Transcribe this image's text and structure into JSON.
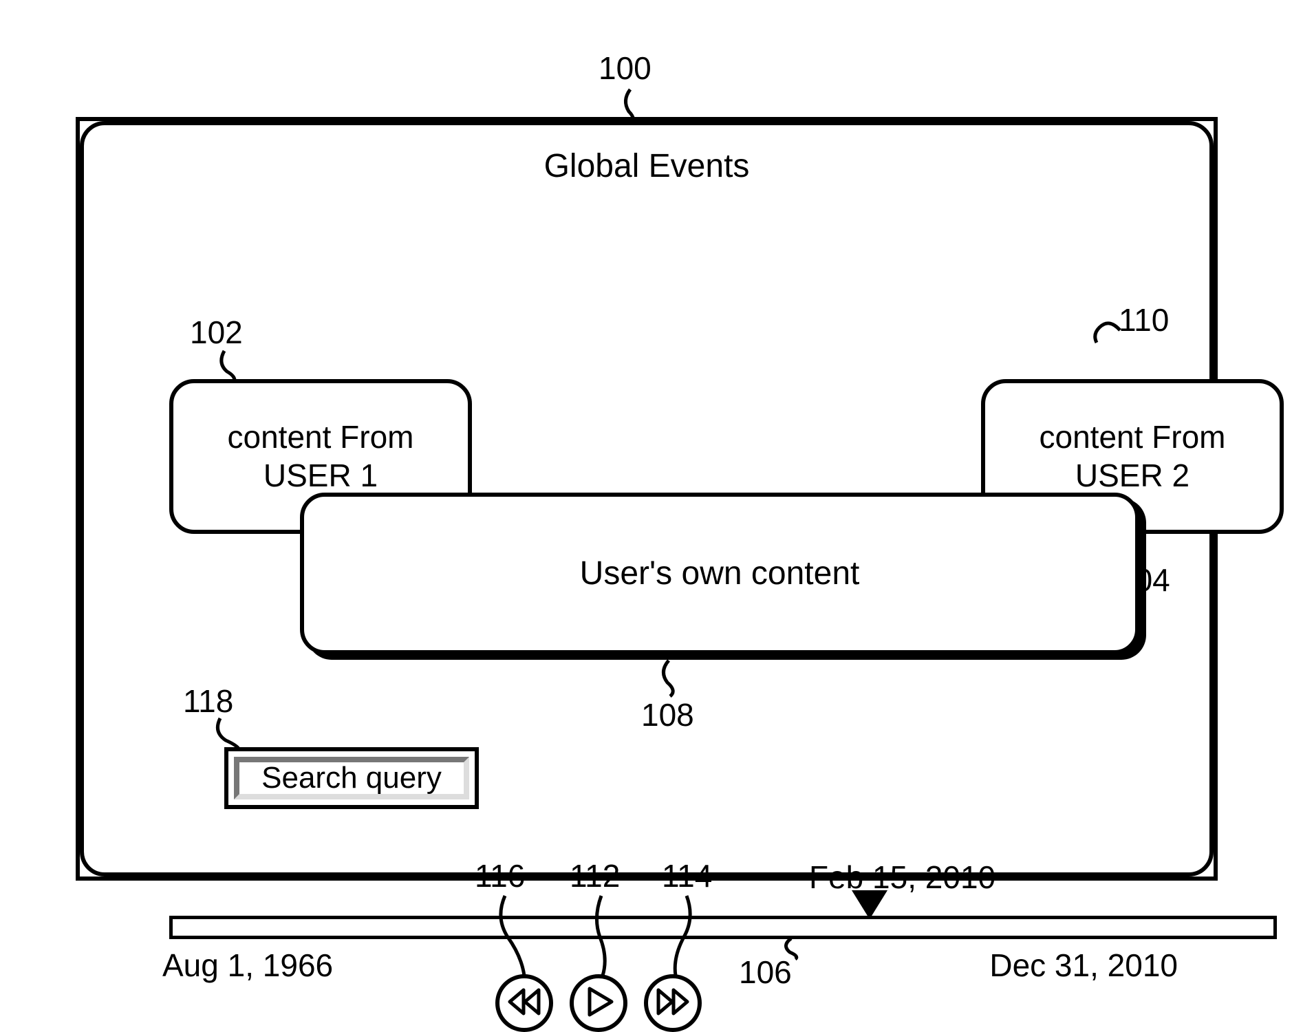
{
  "refs": {
    "r100": "100",
    "r102": "102",
    "r104": "104",
    "r106": "106",
    "r108": "108",
    "r110": "110",
    "r112": "112",
    "r114": "114",
    "r116": "116",
    "r118": "118"
  },
  "boxes": {
    "global": "Global Events",
    "user1_l1": "content From",
    "user1_l2": "USER 1",
    "user2_l1": "content From",
    "user2_l2": "USER 2",
    "own": "User's own content"
  },
  "search": {
    "label": "Search query"
  },
  "timeline": {
    "start": "Aug 1, 1966",
    "end": "Dec 31, 2010",
    "current": "Feb 15, 2010"
  }
}
